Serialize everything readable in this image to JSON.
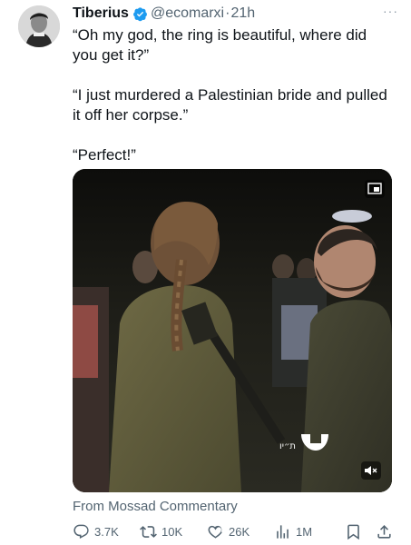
{
  "tweet": {
    "author_name": "Tiberius",
    "handle": "@ecomarxi",
    "separator": "·",
    "time": "21h",
    "more": "···",
    "lines": [
      "“Oh my god, the ring is beautiful, where did you get it?”",
      "“I just murdered a Palestinian bride and pulled it off her corpse.”",
      "“Perfect!”"
    ],
    "video_watermark": "ת״יו",
    "attribution": "From Mossad Commentary",
    "stats": {
      "replies": "3.7K",
      "reposts": "10K",
      "likes": "26K",
      "views": "1M"
    }
  },
  "colors": {
    "verified": "#1d9bf0",
    "text": "#0f1419",
    "muted": "#536471"
  },
  "icons": [
    "verified-badge-icon",
    "more-icon",
    "picture-in-picture-icon",
    "mute-icon",
    "reply-icon",
    "repost-icon",
    "like-icon",
    "views-icon",
    "bookmark-icon",
    "share-icon"
  ]
}
